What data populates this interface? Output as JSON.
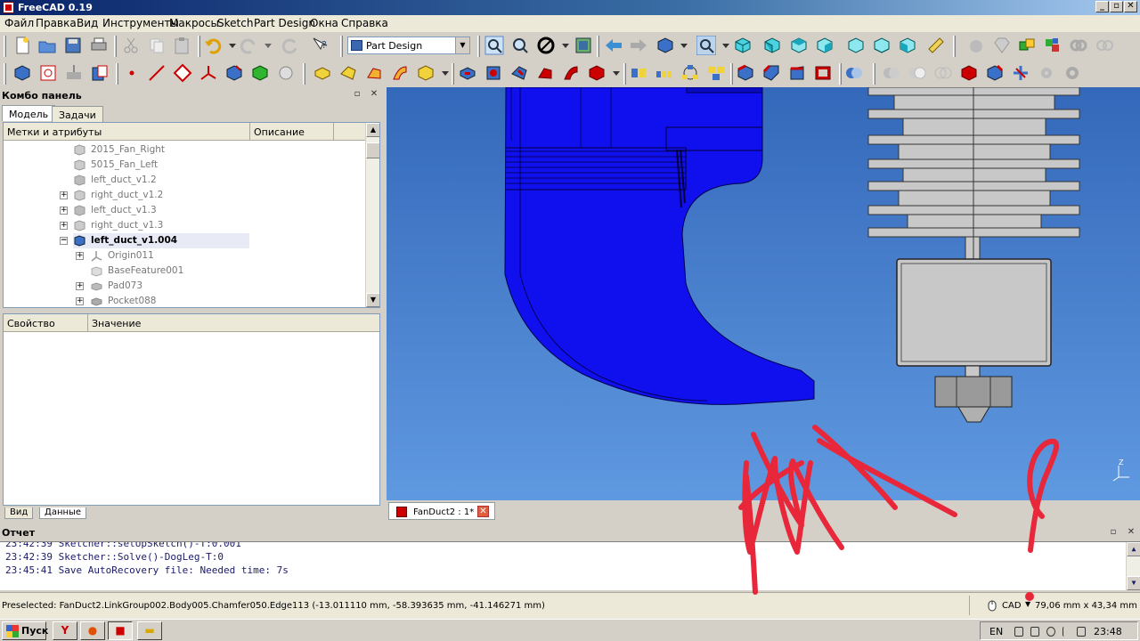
{
  "window": {
    "title": "FreeCAD 0.19",
    "buttons": [
      "_",
      "▫",
      "✕"
    ]
  },
  "menu": [
    "Файл",
    "Правка",
    "Вид",
    "Инструменты",
    "Макросы",
    "Sketch",
    "Part Design",
    "Окна",
    "Справка"
  ],
  "toolbar": {
    "workbench": "Part Design"
  },
  "combo": {
    "title": "Комбо панель",
    "tabs": [
      "Модель",
      "Задачи"
    ],
    "tree": {
      "columns": [
        "Метки и атрибуты",
        "Описание"
      ],
      "items": [
        {
          "label": "2015_Fan_Right"
        },
        {
          "label": "5015_Fan_Left"
        },
        {
          "label": "left_duct_v1.2"
        },
        {
          "label": "right_duct_v1.2"
        },
        {
          "label": "left_duct_v1.3"
        },
        {
          "label": "right_duct_v1.3"
        },
        {
          "label": "left_duct_v1.004"
        },
        {
          "label": "Origin011"
        },
        {
          "label": "BaseFeature001"
        },
        {
          "label": "Pad073"
        },
        {
          "label": "Pocket088"
        }
      ]
    },
    "properties": {
      "columns": [
        "Свойство",
        "Значение"
      ]
    },
    "bottom_tabs": [
      "Вид",
      "Данные"
    ]
  },
  "view": {
    "document_tab": "FanDuct2 : 1*",
    "axis_label": "Z",
    "colors": {
      "duct": "#1010ee",
      "hotend": "#c8c8c8",
      "background_top": "#3468ba",
      "background_bottom": "#5f99e0",
      "scribble": "#e8273a"
    }
  },
  "report": {
    "title": "Отчет",
    "lines": [
      "23:42:39  Sketcher::setUpSketch()-T:0.001",
      "23:42:39  Sketcher::Solve()-DogLeg-T:0",
      "23:45:41  Save AutoRecovery file: Needed time: 7s"
    ]
  },
  "status": {
    "message": "Preselected: FanDuct2.LinkGroup002.Body005.Chamfer050.Edge113 (-13.011110 mm, -58.393635 mm, -41.146271 mm)",
    "navigation": "CAD",
    "dimensions": "79,06 mm x 43,34 mm"
  },
  "taskbar": {
    "start": "Пуск",
    "language": "EN",
    "clock": "23:48"
  }
}
